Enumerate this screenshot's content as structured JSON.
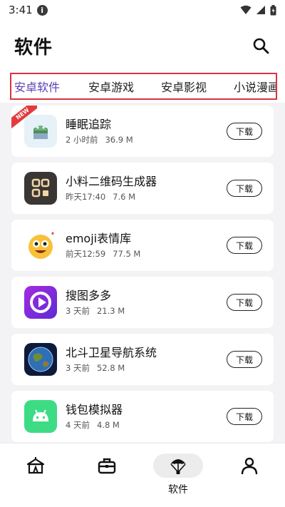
{
  "status_bar": {
    "time": "3:41",
    "info_icon": "info-icon",
    "icons": [
      "wifi-icon",
      "signal-icon",
      "battery-icon"
    ]
  },
  "header": {
    "title": "软件",
    "search_icon": "search-icon"
  },
  "tabs": [
    {
      "label": "安卓软件",
      "active": true
    },
    {
      "label": "安卓游戏",
      "active": false
    },
    {
      "label": "安卓影视",
      "active": false
    },
    {
      "label": "小说漫画",
      "active": false
    }
  ],
  "apps": [
    {
      "name": "睡眠追踪",
      "time": "2 小时前",
      "size": "36.9 M",
      "button": "下载",
      "badge": "NEW",
      "icon": "sleep-tracker-icon"
    },
    {
      "name": "小料二维码生成器",
      "time": "昨天17:40",
      "size": "7.6 M",
      "button": "下载",
      "icon": "qr-code-icon"
    },
    {
      "name": "emoji表情库",
      "time": "前天12:59",
      "size": "77.5 M",
      "button": "下载",
      "icon": "emoji-face-icon"
    },
    {
      "name": "搜图多多",
      "time": "3 天前",
      "size": "21.3 M",
      "button": "下载",
      "icon": "play-image-icon"
    },
    {
      "name": "北斗卫星导航系统",
      "time": "3 天前",
      "size": "52.8 M",
      "button": "下载",
      "icon": "earth-globe-icon"
    },
    {
      "name": "钱包模拟器",
      "time": "4 天前",
      "size": "4.8 M",
      "button": "下载",
      "icon": "android-icon"
    }
  ],
  "bottom_nav": [
    {
      "icon": "home-tent-icon",
      "label": ""
    },
    {
      "icon": "toolbox-icon",
      "label": ""
    },
    {
      "icon": "parachute-icon",
      "label": "软件",
      "active": true
    },
    {
      "icon": "person-icon",
      "label": ""
    }
  ]
}
